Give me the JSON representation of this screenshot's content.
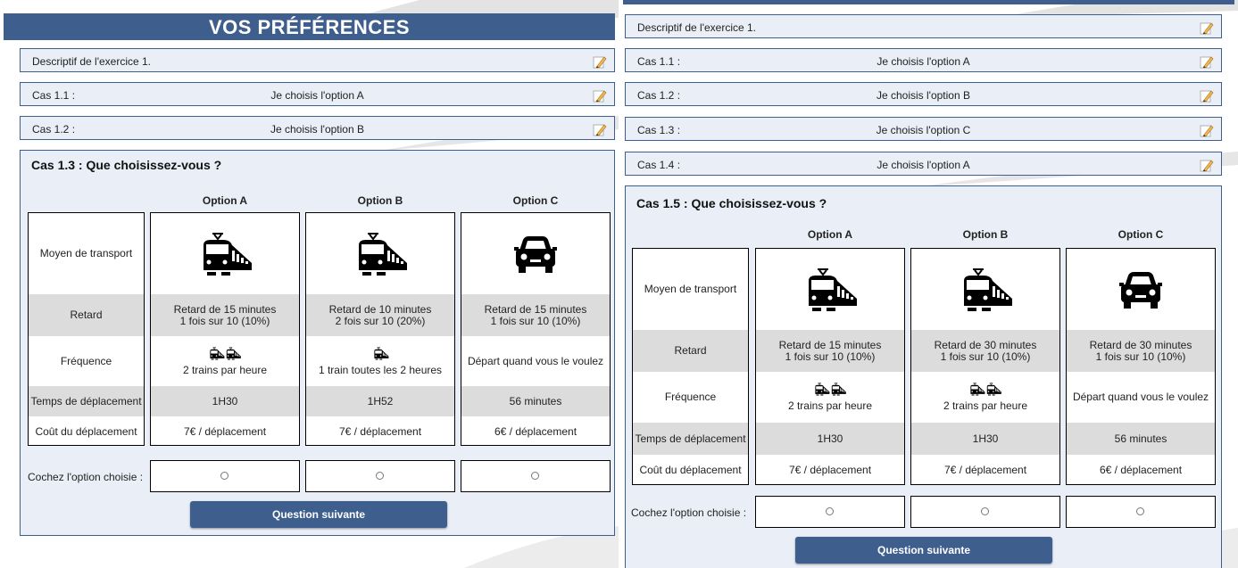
{
  "colors": {
    "accent": "#3e5f8e",
    "row_bg": "#e9eef7",
    "grey_cell": "#dcdcdc"
  },
  "icons": {
    "edit": "pencil-edit-icon",
    "train": "train-icon",
    "car": "car-icon",
    "radio": "radio-button"
  },
  "left": {
    "title": "VOS PRÉFÉRENCES",
    "rows": [
      {
        "label": "Descriptif de l'exercice 1.",
        "answer": ""
      },
      {
        "label": "Cas 1.1 :",
        "answer": "Je choisis l'option A"
      },
      {
        "label": "Cas 1.2 :",
        "answer": "Je choisis l'option B"
      }
    ],
    "question": {
      "title": "Cas 1.3 : Que choisissez-vous ?",
      "row_labels": {
        "transport": "Moyen de transport",
        "retard": "Retard",
        "frequence": "Fréquence",
        "temps": "Temps de déplacement",
        "cout": "Coût du déplacement"
      },
      "options": [
        {
          "name": "Option A",
          "transport": "train",
          "retard_l1": "Retard de 15 minutes",
          "retard_l2": "1 fois sur 10 (10%)",
          "freq_icons": 2,
          "frequence": "2 trains par heure",
          "temps": "1H30",
          "cout": "7€ / déplacement"
        },
        {
          "name": "Option B",
          "transport": "train",
          "retard_l1": "Retard de 10 minutes",
          "retard_l2": "2 fois sur 10 (20%)",
          "freq_icons": 1,
          "frequence": "1 train toutes les 2 heures",
          "temps": "1H52",
          "cout": "7€ / déplacement"
        },
        {
          "name": "Option C",
          "transport": "car",
          "retard_l1": "Retard de 15 minutes",
          "retard_l2": "1 fois sur 10 (10%)",
          "freq_icons": 0,
          "frequence": "Départ quand vous le voulez",
          "temps": "56 minutes",
          "cout": "6€ / déplacement"
        }
      ],
      "check_label": "Cochez l'option choisie :",
      "next_button": "Question suivante"
    }
  },
  "right": {
    "rows": [
      {
        "label": "Descriptif de l'exercice 1.",
        "answer": ""
      },
      {
        "label": "Cas 1.1 :",
        "answer": "Je choisis l'option A"
      },
      {
        "label": "Cas 1.2 :",
        "answer": "Je choisis l'option B"
      },
      {
        "label": "Cas 1.3 :",
        "answer": "Je choisis l'option C"
      },
      {
        "label": "Cas 1.4 :",
        "answer": "Je choisis l'option A"
      }
    ],
    "question": {
      "title": "Cas 1.5 : Que choisissez-vous ?",
      "row_labels": {
        "transport": "Moyen de transport",
        "retard": "Retard",
        "frequence": "Fréquence",
        "temps": "Temps de déplacement",
        "cout": "Coût du déplacement"
      },
      "options": [
        {
          "name": "Option A",
          "transport": "train",
          "retard_l1": "Retard de 15 minutes",
          "retard_l2": "1 fois sur 10 (10%)",
          "freq_icons": 2,
          "frequence": "2 trains par heure",
          "temps": "1H30",
          "cout": "7€ / déplacement"
        },
        {
          "name": "Option B",
          "transport": "train",
          "retard_l1": "Retard de 30 minutes",
          "retard_l2": "1 fois sur 10 (10%)",
          "freq_icons": 2,
          "frequence": "2 trains par heure",
          "temps": "1H30",
          "cout": "7€ / déplacement"
        },
        {
          "name": "Option C",
          "transport": "car",
          "retard_l1": "Retard de 30 minutes",
          "retard_l2": "1 fois sur 10 (10%)",
          "freq_icons": 0,
          "frequence": "Départ quand vous le voulez",
          "temps": "56 minutes",
          "cout": "6€ / déplacement"
        }
      ],
      "check_label": "Cochez l'option choisie :",
      "next_button": "Question suivante"
    }
  }
}
